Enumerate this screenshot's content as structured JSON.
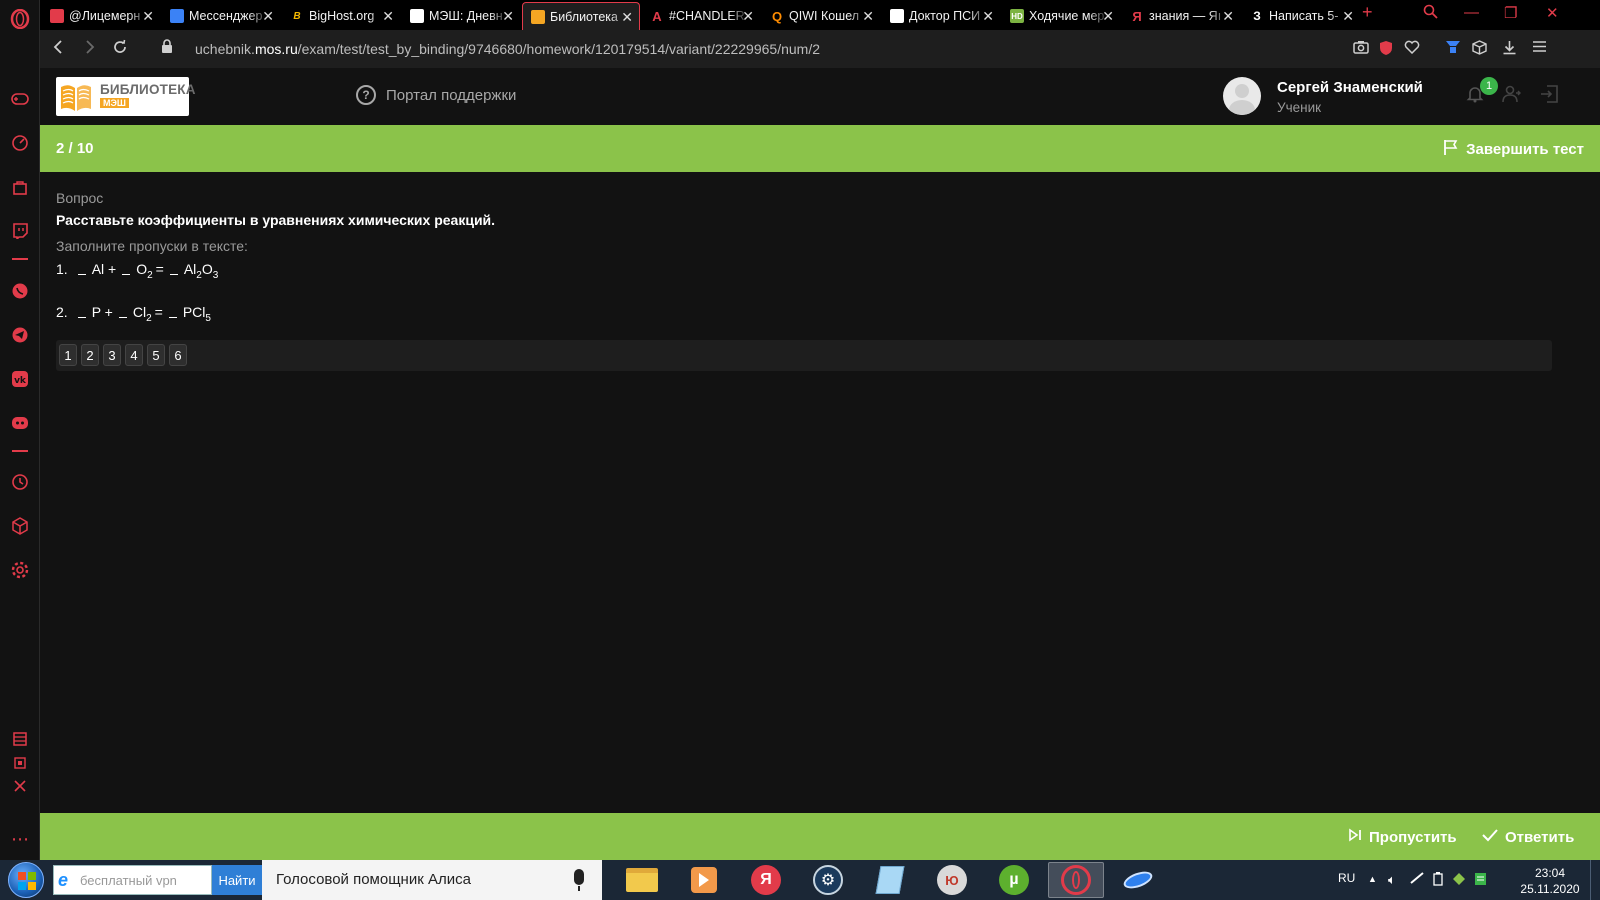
{
  "browser": {
    "tabs": [
      {
        "title": "@Лицемерн",
        "favicon": "LH",
        "fav_color": "#e23b4a",
        "active": false
      },
      {
        "title": "Мессенджер",
        "favicon": "M",
        "fav_color": "#3b82f6",
        "active": false
      },
      {
        "title": "BigHost.org",
        "favicon": "B",
        "fav_color": "#f5b800",
        "active": false
      },
      {
        "title": "МЭШ: Дневн",
        "favicon": "",
        "fav_color": "#ffffff",
        "active": false
      },
      {
        "title": "Библиотека",
        "favicon": "Б",
        "fav_color": "#f5a623",
        "active": true
      },
      {
        "title": "#CHANDLER",
        "favicon": "A",
        "fav_color": "#e23b4a",
        "active": false
      },
      {
        "title": "QIWI Кошел",
        "favicon": "Q",
        "fav_color": "#ff8c00",
        "active": false
      },
      {
        "title": "Доктор ПСИ",
        "favicon": "D",
        "fav_color": "#ffffff",
        "active": false
      },
      {
        "title": "Ходячие мер",
        "favicon": "HD",
        "fav_color": "#7cb342",
        "active": false
      },
      {
        "title": "знания — Яı",
        "favicon": "Я",
        "fav_color": "#e23b4a",
        "active": false
      },
      {
        "title": "Написать 5-",
        "favicon": "З",
        "fav_color": "#ffffff",
        "active": false
      }
    ],
    "url_prefix": "uchebnik.",
    "url_domain": "mos.ru",
    "url_path": "/exam/test/test_by_binding/9746680/homework/120179514/variant/22229965/num/2"
  },
  "site": {
    "logo_line1": "БИБЛИОТЕКА",
    "logo_line2": "МЭШ",
    "support_label": "Портал поддержки",
    "user_name": "Сергей Знаменский",
    "user_role": "Ученик",
    "notifications_count": "1"
  },
  "test": {
    "progress": "2 / 10",
    "finish_label": "Завершить тест",
    "question_label": "Вопрос",
    "question_text": "Расставьте коэффициенты в уравнениях химических реакций.",
    "hint": "Заполните пропуски в тексте:",
    "eq1": {
      "num": "1.",
      "a": "Al +",
      "b": "O",
      "b_sub": "2",
      "eq": "=",
      "c1": "Al",
      "c1_sub": "2",
      "c2": "O",
      "c2_sub": "3"
    },
    "eq2": {
      "num": "2.",
      "a": "P +",
      "b": "Cl",
      "b_sub": "2",
      "eq": "=",
      "c1": "PCl",
      "c1_sub": "5"
    },
    "chips": [
      "1",
      "2",
      "3",
      "4",
      "5",
      "6"
    ],
    "skip_label": "Пропустить",
    "answer_label": "Ответить"
  },
  "taskbar": {
    "search_placeholder": "бесплатный vpn",
    "search_button": "Найти",
    "alice_label": "Голосовой помощник Алиса",
    "lang": "RU",
    "time": "23:04",
    "date": "25.11.2020"
  },
  "colors": {
    "accent_green": "#8bc34a",
    "opera_red": "#e23b4a",
    "background": "#121212"
  }
}
